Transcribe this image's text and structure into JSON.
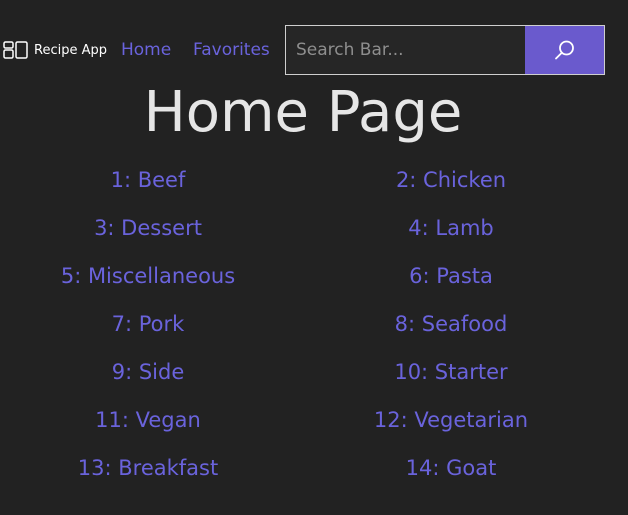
{
  "navbar": {
    "brand": "Recipe App",
    "brand_icon": "dashboard-icon",
    "links": [
      "Home",
      "Favorites"
    ],
    "search": {
      "placeholder": "Search Bar...",
      "value": "",
      "button_icon": "search-icon"
    }
  },
  "page": {
    "title": "Home Page"
  },
  "categories": [
    "1: Beef",
    "2: Chicken",
    "3: Dessert",
    "4: Lamb",
    "5: Miscellaneous",
    "6: Pasta",
    "7: Pork",
    "8: Seafood",
    "9: Side",
    "10: Starter",
    "11: Vegan",
    "12: Vegetarian",
    "13: Breakfast",
    "14: Goat"
  ],
  "colors": {
    "background": "#222222",
    "link": "#6a63dc",
    "search_button": "#6a5acd",
    "title": "#e6e6e6"
  }
}
